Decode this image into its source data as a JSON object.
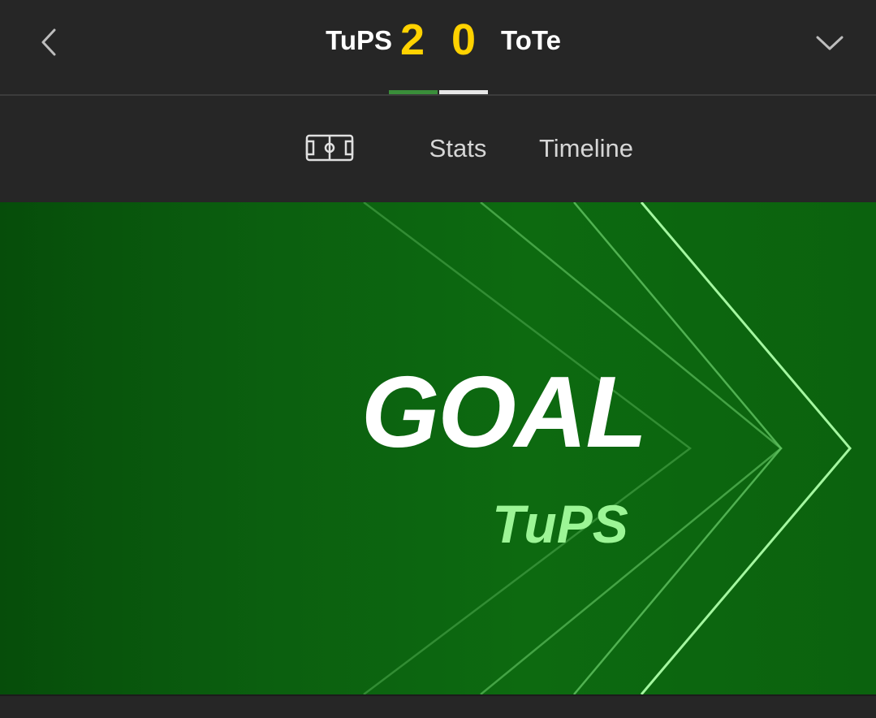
{
  "header": {
    "back_icon": "chevron-left-icon",
    "expand_icon": "chevron-down-icon",
    "home_team": "TuPS",
    "home_score": "2",
    "away_score": "0",
    "away_team": "ToTe",
    "colors": {
      "score": "#ffd200",
      "home_team_color": "#3a8e3a",
      "away_team_color": "#e6e6e6"
    }
  },
  "tabs": {
    "items": [
      {
        "icon": "pitch-icon",
        "active": true
      },
      {
        "label": "Stats",
        "active": false
      },
      {
        "label": "Timeline",
        "active": false
      }
    ]
  },
  "event": {
    "title": "GOAL",
    "team": "TuPS",
    "colors": {
      "background": "#0b620e",
      "team_text": "#9cf596"
    }
  }
}
